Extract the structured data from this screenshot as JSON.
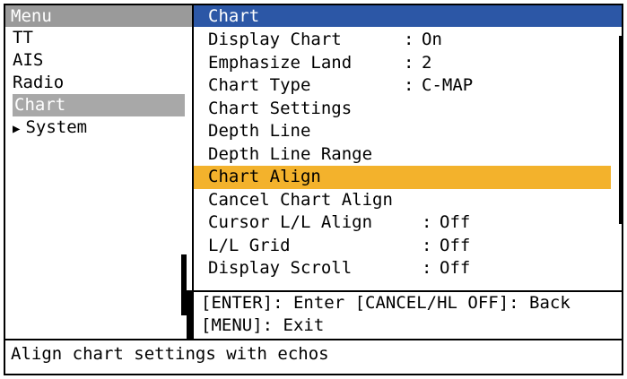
{
  "left_menu": {
    "title": "Menu",
    "items": [
      {
        "label": "TT",
        "selected": false
      },
      {
        "label": "AIS",
        "selected": false
      },
      {
        "label": "Radio",
        "selected": false
      },
      {
        "label": "Chart",
        "selected": true
      },
      {
        "label": "System",
        "selected": false,
        "has_arrow": true
      }
    ]
  },
  "chart_menu": {
    "title": "Chart",
    "items": [
      {
        "label": "Display Chart",
        "value": "On"
      },
      {
        "label": "Emphasize Land",
        "value": "2"
      },
      {
        "label": "Chart Type",
        "value": "C-MAP"
      },
      {
        "label": "Chart Settings",
        "value": ""
      },
      {
        "label": "Depth Line",
        "value": ""
      },
      {
        "label": "Depth Line Range",
        "value": ""
      },
      {
        "label": "Chart Align",
        "value": "",
        "highlighted": true
      },
      {
        "label": "Cancel Chart Align",
        "value": ""
      },
      {
        "label": "Cursor L/L Align",
        "value": "Off"
      },
      {
        "label": "L/L Grid",
        "value": "Off"
      },
      {
        "label": "Display Scroll",
        "value": "Off"
      }
    ]
  },
  "help": {
    "line1": "[ENTER]: Enter [CANCEL/HL OFF]: Back",
    "line2": "[MENU]: Exit"
  },
  "status": "Align chart settings with echos",
  "colors": {
    "header_blue": "#2c57a6",
    "highlight_orange": "#f3b22c",
    "selected_gray": "#a8a8a8"
  }
}
